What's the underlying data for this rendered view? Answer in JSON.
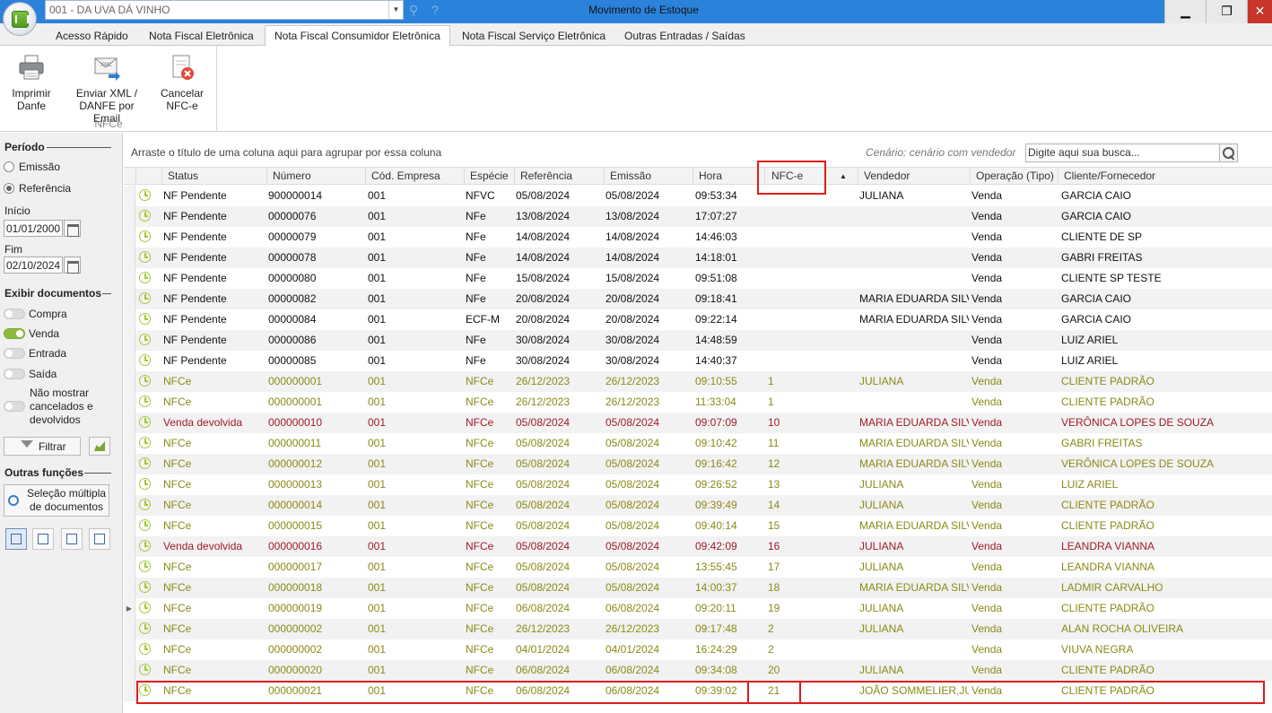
{
  "titlebar": {
    "company": "001 - DA UVA DÁ VINHO",
    "window_title": "Movimento de Estoque",
    "minimize": "▁",
    "restore": "❐",
    "close": "✕"
  },
  "tabs": [
    {
      "label": "Acesso Rápido"
    },
    {
      "label": "Nota Fiscal Eletrônica"
    },
    {
      "label": "Nota Fiscal Consumidor Eletrônica"
    },
    {
      "label": "Nota Fiscal Serviço Eletrônica"
    },
    {
      "label": "Outras Entradas / Saídas"
    }
  ],
  "active_tab_index": 2,
  "ribbon": {
    "group_label": "NFCe",
    "buttons": [
      {
        "label_1": "Imprimir",
        "label_2": "Danfe",
        "icon": "printer-icon"
      },
      {
        "label_1": "Enviar XML /",
        "label_2": "DANFE por Email",
        "icon": "email-xml-icon"
      },
      {
        "label_1": "Cancelar",
        "label_2": "NFC-e",
        "icon": "cancel-document-icon"
      }
    ]
  },
  "left": {
    "periodo_title": "Período",
    "emissao": "Emissão",
    "referencia": "Referência",
    "selected_period": "Referência",
    "inicio_label": "Início",
    "inicio_value": "01/01/2000",
    "fim_label": "Fim",
    "fim_value": "02/10/2024",
    "exibir_title": "Exibir documentos",
    "compra": "Compra",
    "venda": "Venda",
    "entrada": "Entrada",
    "saida": "Saída",
    "nao_mostrar_1": "Não mostrar",
    "nao_mostrar_2": "cancelados e",
    "nao_mostrar_3": "devolvidos",
    "toggles": {
      "compra": false,
      "venda": true,
      "entrada": false,
      "saida": false,
      "nao_mostrar": false
    },
    "filtrar": "Filtrar",
    "outras_title": "Outras funções",
    "selecao_1": "Seleção múltipla",
    "selecao_2": "de documentos"
  },
  "grid": {
    "group_hint": "Arraste o título de uma coluna aqui para agrupar por essa coluna",
    "scenario": "Cenário: cenário com vendedor",
    "search_placeholder": "Digite aqui sua busca...",
    "columns": [
      "Status",
      "Número",
      "Cód. Empresa",
      "Espécie",
      "Referência",
      "Emissão",
      "Hora",
      "NFC-e",
      "Vendedor",
      "Operação (Tipo)",
      "Cliente/Fornecedor"
    ],
    "sorted_column": "NFC-e",
    "rows": [
      {
        "status": "NF Pendente",
        "numero": "900000014",
        "empresa": "001",
        "especie": "NFVC",
        "referencia": "05/08/2024",
        "emissao": "05/08/2024",
        "hora": "09:53:34",
        "nfce": "",
        "vendedor": "JULIANA",
        "operacao": "Venda",
        "cliente": "GARCIA CAIO",
        "color": "black"
      },
      {
        "status": "NF Pendente",
        "numero": "00000076",
        "empresa": "001",
        "especie": "NFe",
        "referencia": "13/08/2024",
        "emissao": "13/08/2024",
        "hora": "17:07:27",
        "nfce": "",
        "vendedor": "",
        "operacao": "Venda",
        "cliente": "GARCIA CAIO",
        "color": "black"
      },
      {
        "status": "NF Pendente",
        "numero": "00000079",
        "empresa": "001",
        "especie": "NFe",
        "referencia": "14/08/2024",
        "emissao": "14/08/2024",
        "hora": "14:46:03",
        "nfce": "",
        "vendedor": "",
        "operacao": "Venda",
        "cliente": "CLIENTE DE SP",
        "color": "black"
      },
      {
        "status": "NF Pendente",
        "numero": "00000078",
        "empresa": "001",
        "especie": "NFe",
        "referencia": "14/08/2024",
        "emissao": "14/08/2024",
        "hora": "14:18:01",
        "nfce": "",
        "vendedor": "",
        "operacao": "Venda",
        "cliente": "GABRI FREITAS",
        "color": "black"
      },
      {
        "status": "NF Pendente",
        "numero": "00000080",
        "empresa": "001",
        "especie": "NFe",
        "referencia": "15/08/2024",
        "emissao": "15/08/2024",
        "hora": "09:51:08",
        "nfce": "",
        "vendedor": "",
        "operacao": "Venda",
        "cliente": "CLIENTE SP TESTE",
        "color": "black"
      },
      {
        "status": "NF Pendente",
        "numero": "00000082",
        "empresa": "001",
        "especie": "NFe",
        "referencia": "20/08/2024",
        "emissao": "20/08/2024",
        "hora": "09:18:41",
        "nfce": "",
        "vendedor": "MARIA EDUARDA SILVA",
        "operacao": "Venda",
        "cliente": "GARCIA CAIO",
        "color": "black"
      },
      {
        "status": "NF Pendente",
        "numero": "00000084",
        "empresa": "001",
        "especie": "ECF-M",
        "referencia": "20/08/2024",
        "emissao": "20/08/2024",
        "hora": "09:22:14",
        "nfce": "",
        "vendedor": "MARIA EDUARDA SILVA",
        "operacao": "Venda",
        "cliente": "GARCIA CAIO",
        "color": "black"
      },
      {
        "status": "NF Pendente",
        "numero": "00000086",
        "empresa": "001",
        "especie": "NFe",
        "referencia": "30/08/2024",
        "emissao": "30/08/2024",
        "hora": "14:48:59",
        "nfce": "",
        "vendedor": "",
        "operacao": "Venda",
        "cliente": "LUIZ ARIEL",
        "color": "black"
      },
      {
        "status": "NF Pendente",
        "numero": "00000085",
        "empresa": "001",
        "especie": "NFe",
        "referencia": "30/08/2024",
        "emissao": "30/08/2024",
        "hora": "14:40:37",
        "nfce": "",
        "vendedor": "",
        "operacao": "Venda",
        "cliente": "LUIZ ARIEL",
        "color": "black"
      },
      {
        "status": "NFCe",
        "numero": "000000001",
        "empresa": "001",
        "especie": "NFCe",
        "referencia": "26/12/2023",
        "emissao": "26/12/2023",
        "hora": "09:10:55",
        "nfce": "1",
        "vendedor": "JULIANA",
        "operacao": "Venda",
        "cliente": "CLIENTE PADRÃO",
        "color": "green"
      },
      {
        "status": "NFCe",
        "numero": "000000001",
        "empresa": "001",
        "especie": "NFCe",
        "referencia": "26/12/2023",
        "emissao": "26/12/2023",
        "hora": "11:33:04",
        "nfce": "1",
        "vendedor": "",
        "operacao": "Venda",
        "cliente": "CLIENTE PADRÃO",
        "color": "green"
      },
      {
        "status": "Venda devolvida",
        "numero": "000000010",
        "empresa": "001",
        "especie": "NFCe",
        "referencia": "05/08/2024",
        "emissao": "05/08/2024",
        "hora": "09:07:09",
        "nfce": "10",
        "vendedor": "MARIA EDUARDA SILVA",
        "operacao": "Venda",
        "cliente": "VERÔNICA LOPES DE SOUZA",
        "color": "red"
      },
      {
        "status": "NFCe",
        "numero": "000000011",
        "empresa": "001",
        "especie": "NFCe",
        "referencia": "05/08/2024",
        "emissao": "05/08/2024",
        "hora": "09:10:42",
        "nfce": "11",
        "vendedor": "MARIA EDUARDA SILVA",
        "operacao": "Venda",
        "cliente": "GABRI FREITAS",
        "color": "green"
      },
      {
        "status": "NFCe",
        "numero": "000000012",
        "empresa": "001",
        "especie": "NFCe",
        "referencia": "05/08/2024",
        "emissao": "05/08/2024",
        "hora": "09:16:42",
        "nfce": "12",
        "vendedor": "MARIA EDUARDA SILVA",
        "operacao": "Venda",
        "cliente": "VERÔNICA LOPES DE SOUZA",
        "color": "green"
      },
      {
        "status": "NFCe",
        "numero": "000000013",
        "empresa": "001",
        "especie": "NFCe",
        "referencia": "05/08/2024",
        "emissao": "05/08/2024",
        "hora": "09:26:52",
        "nfce": "13",
        "vendedor": "JULIANA",
        "operacao": "Venda",
        "cliente": "LUIZ ARIEL",
        "color": "green"
      },
      {
        "status": "NFCe",
        "numero": "000000014",
        "empresa": "001",
        "especie": "NFCe",
        "referencia": "05/08/2024",
        "emissao": "05/08/2024",
        "hora": "09:39:49",
        "nfce": "14",
        "vendedor": "JULIANA",
        "operacao": "Venda",
        "cliente": "CLIENTE PADRÃO",
        "color": "green"
      },
      {
        "status": "NFCe",
        "numero": "000000015",
        "empresa": "001",
        "especie": "NFCe",
        "referencia": "05/08/2024",
        "emissao": "05/08/2024",
        "hora": "09:40:14",
        "nfce": "15",
        "vendedor": "MARIA EDUARDA SILVA",
        "operacao": "Venda",
        "cliente": "CLIENTE PADRÃO",
        "color": "green"
      },
      {
        "status": "Venda devolvida",
        "numero": "000000016",
        "empresa": "001",
        "especie": "NFCe",
        "referencia": "05/08/2024",
        "emissao": "05/08/2024",
        "hora": "09:42:09",
        "nfce": "16",
        "vendedor": "JULIANA",
        "operacao": "Venda",
        "cliente": "LEANDRA VIANNA",
        "color": "red"
      },
      {
        "status": "NFCe",
        "numero": "000000017",
        "empresa": "001",
        "especie": "NFCe",
        "referencia": "05/08/2024",
        "emissao": "05/08/2024",
        "hora": "13:55:45",
        "nfce": "17",
        "vendedor": "JULIANA",
        "operacao": "Venda",
        "cliente": "LEANDRA VIANNA",
        "color": "green"
      },
      {
        "status": "NFCe",
        "numero": "000000018",
        "empresa": "001",
        "especie": "NFCe",
        "referencia": "05/08/2024",
        "emissao": "05/08/2024",
        "hora": "14:00:37",
        "nfce": "18",
        "vendedor": "MARIA EDUARDA SILVA",
        "operacao": "Venda",
        "cliente": "LADMIR CARVALHO",
        "color": "green"
      },
      {
        "status": "NFCe",
        "numero": "000000019",
        "empresa": "001",
        "especie": "NFCe",
        "referencia": "06/08/2024",
        "emissao": "06/08/2024",
        "hora": "09:20:11",
        "nfce": "19",
        "vendedor": "JULIANA",
        "operacao": "Venda",
        "cliente": "CLIENTE PADRÃO",
        "color": "green"
      },
      {
        "status": "NFCe",
        "numero": "000000002",
        "empresa": "001",
        "especie": "NFCe",
        "referencia": "26/12/2023",
        "emissao": "26/12/2023",
        "hora": "09:17:48",
        "nfce": "2",
        "vendedor": "JULIANA",
        "operacao": "Venda",
        "cliente": "ALAN ROCHA OLIVEIRA",
        "color": "green"
      },
      {
        "status": "NFCe",
        "numero": "000000002",
        "empresa": "001",
        "especie": "NFCe",
        "referencia": "04/01/2024",
        "emissao": "04/01/2024",
        "hora": "16:24:29",
        "nfce": "2",
        "vendedor": "",
        "operacao": "Venda",
        "cliente": "VIUVA NEGRA",
        "color": "green"
      },
      {
        "status": "NFCe",
        "numero": "000000020",
        "empresa": "001",
        "especie": "NFCe",
        "referencia": "06/08/2024",
        "emissao": "06/08/2024",
        "hora": "09:34:08",
        "nfce": "20",
        "vendedor": "JULIANA",
        "operacao": "Venda",
        "cliente": "CLIENTE PADRÃO",
        "color": "green"
      },
      {
        "status": "NFCe",
        "numero": "000000021",
        "empresa": "001",
        "especie": "NFCe",
        "referencia": "06/08/2024",
        "emissao": "06/08/2024",
        "hora": "09:39:02",
        "nfce": "21",
        "vendedor": "JOÃO SOMMELIER,JULIANA",
        "operacao": "Venda",
        "cliente": "CLIENTE PADRÃO",
        "color": "green"
      }
    ],
    "current_row_index": 20,
    "highlight_row_index": 24
  },
  "colors": {
    "titlebar": "#2a82da",
    "pending_text": "#111111",
    "nfce_text": "#8a8a16",
    "returned_text": "#a01a2a",
    "highlight_box": "#e01b1b",
    "toggle_on": "#8dbb3e"
  }
}
